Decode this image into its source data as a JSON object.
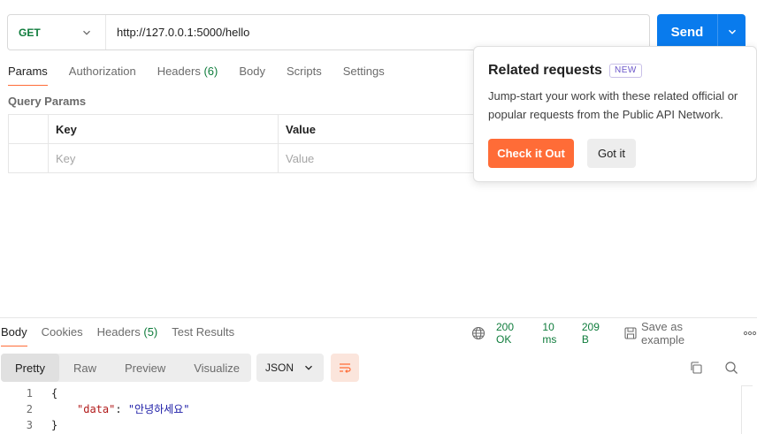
{
  "request": {
    "method": "GET",
    "url": "http://127.0.0.1:5000/hello",
    "send_label": "Send"
  },
  "request_tabs": [
    {
      "label": "Params",
      "count": ""
    },
    {
      "label": "Authorization",
      "count": ""
    },
    {
      "label": "Headers",
      "count": "(6)"
    },
    {
      "label": "Body",
      "count": ""
    },
    {
      "label": "Scripts",
      "count": ""
    },
    {
      "label": "Settings",
      "count": ""
    }
  ],
  "query_params": {
    "title": "Query Params",
    "headers": {
      "key": "Key",
      "value": "Value"
    },
    "placeholders": {
      "key": "Key",
      "value": "Value"
    }
  },
  "popover": {
    "title": "Related requests",
    "badge": "NEW",
    "description": "Jump-start your work with these related official or popular requests from the Public API Network.",
    "primary_button": "Check it Out",
    "secondary_button": "Got it"
  },
  "response_tabs": [
    {
      "label": "Body",
      "count": ""
    },
    {
      "label": "Cookies",
      "count": ""
    },
    {
      "label": "Headers",
      "count": "(5)"
    },
    {
      "label": "Test Results",
      "count": ""
    }
  ],
  "response_meta": {
    "status": "200 OK",
    "time": "10 ms",
    "size": "209 B",
    "save_label": "Save as example"
  },
  "format_tabs": [
    "Pretty",
    "Raw",
    "Preview",
    "Visualize"
  ],
  "language": "JSON",
  "code": {
    "lines": [
      {
        "num": "1",
        "text": "{"
      },
      {
        "num": "2",
        "key": "\"data\"",
        "sep": ": ",
        "value": "\"안녕하세요\""
      },
      {
        "num": "3",
        "text": "}"
      }
    ]
  },
  "colors": {
    "accent": "#ff6c37",
    "send": "#097bed",
    "method_get": "#0f7c3c",
    "status_ok": "#0f7c3c"
  },
  "icons": {
    "method_dropdown": "chevron-down-icon",
    "send_dropdown": "chevron-down-icon",
    "network": "globe-icon",
    "save": "save-icon",
    "more": "more-horizontal-icon",
    "wrap": "wrap-lines-icon",
    "copy": "copy-icon",
    "search": "search-icon"
  }
}
